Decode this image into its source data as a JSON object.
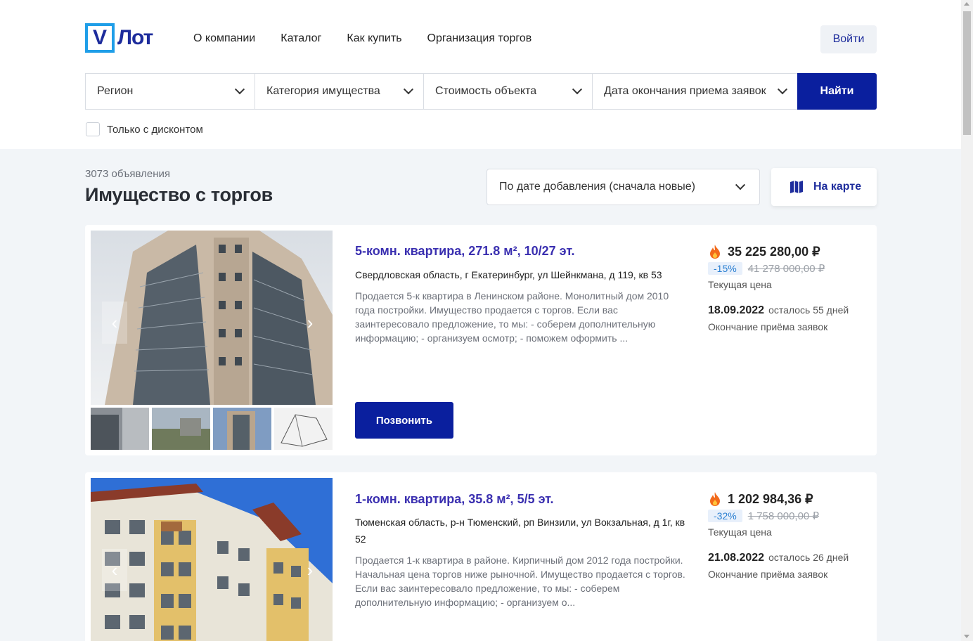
{
  "header": {
    "logo_letter": "V",
    "logo_text": "Лот",
    "nav": [
      "О компании",
      "Каталог",
      "Как купить",
      "Организация торгов"
    ],
    "login_label": "Войти"
  },
  "filters": {
    "region": "Регион",
    "category": "Категория имущества",
    "price": "Стоимость объекта",
    "date": "Дата окончания приема заявок",
    "search_label": "Найти",
    "discount_only": "Только с дисконтом"
  },
  "listing": {
    "count": "3073 объявления",
    "title": "Имущество с торгов",
    "sort": "По дате добавления (сначала новые)",
    "map_label": "На карте"
  },
  "cards": [
    {
      "title": "5-комн. квартира, 271.8 м², 10/27 эт.",
      "address": "Свердловская область, г Екатеринбург, ул Шейнкмана, д 119, кв 53",
      "description": "Продается 5-к квартира в Ленинском районе. Монолитный дом 2010 года постройки. Имущество продается с торгов. Если вас заинтересовало предложение, то мы: - соберем дополнительную информацию; - организуем осмотр; - поможем оформить ...",
      "call_label": "Позвонить",
      "price": "35 225 280,00 ₽",
      "discount": "-15%",
      "old_price": "41 278 000,00 ₽",
      "price_label": "Текущая цена",
      "end_date": "18.09.2022",
      "days_left": "осталось 55 дней",
      "end_label": "Окончание приёма заявок"
    },
    {
      "title": "1-комн. квартира, 35.8 м², 5/5 эт.",
      "address": "Тюменская область, р-н Тюменский, рп Винзили, ул Вокзальная, д 1г, кв 52",
      "description": "Продается 1-к квартира в районе. Кирпичный дом 2012 года постройки. Начальная цена торгов ниже рыночной. Имущество продается с торгов. Если вас заинтересовало предложение, то мы: - соберем дополнительную информацию; - организуем о...",
      "price": "1 202 984,36 ₽",
      "discount": "-32%",
      "old_price": "1 758 000,00 ₽",
      "price_label": "Текущая цена",
      "end_date": "21.08.2022",
      "days_left": "осталось 26 дней",
      "end_label": "Окончание приёма заявок"
    }
  ],
  "colors": {
    "brand": "#0a1f9e",
    "logo_blue": "#1f9ee8",
    "title_purple": "#3a2fb0",
    "fire": "#f26a1b"
  }
}
